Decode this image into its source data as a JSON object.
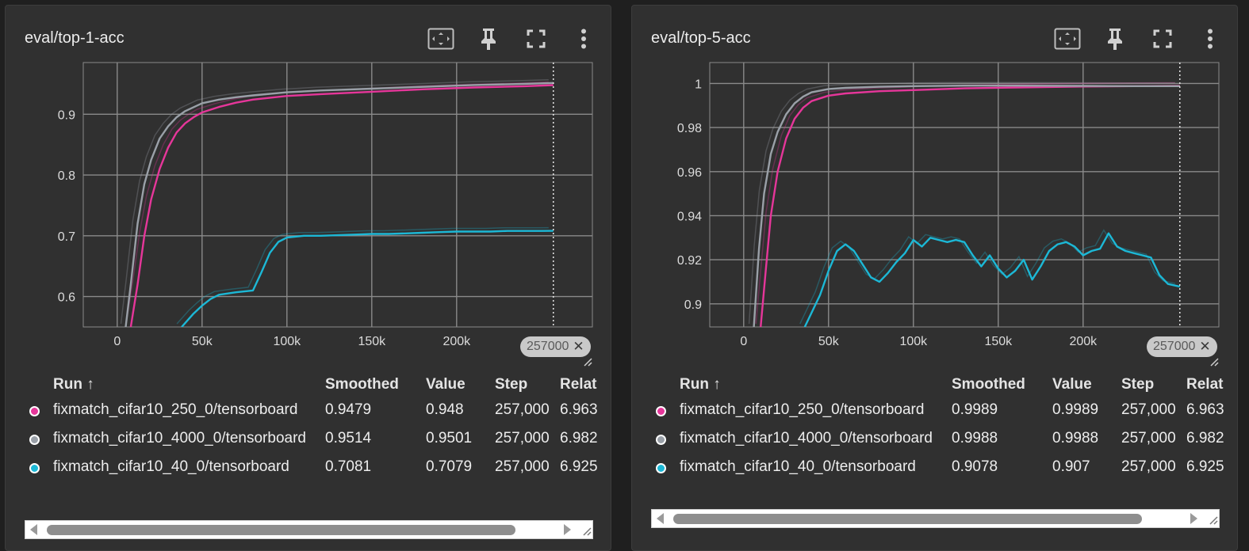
{
  "colors": {
    "background": "#1f1f1f",
    "card": "#303030",
    "grid": "#8a8a8a",
    "magenta": "#e6369a",
    "gray": "#9aa0a8",
    "cyan": "#1cb8d6"
  },
  "icons": [
    "fit-domain-icon",
    "pin-icon",
    "fullscreen-icon",
    "more-vert-icon",
    "close-icon",
    "resize-icon",
    "scroll-left-icon",
    "scroll-right-icon"
  ],
  "table_headers": {
    "run": "Run ↑",
    "smoothed": "Smoothed",
    "value": "Value",
    "step": "Step",
    "relative": "Relat"
  },
  "panels": [
    {
      "title": "eval/top-1-acc",
      "range_chip": "257000",
      "rows": [
        {
          "run": "fixmatch_cifar10_250_0/tensorboard",
          "smoothed": "0.9479",
          "value": "0.948",
          "step": "257,000",
          "relative": "6.963",
          "color": "#e6369a"
        },
        {
          "run": "fixmatch_cifar10_4000_0/tensorboard",
          "smoothed": "0.9514",
          "value": "0.9501",
          "step": "257,000",
          "relative": "6.982",
          "color": "#9aa0a8"
        },
        {
          "run": "fixmatch_cifar10_40_0/tensorboard",
          "smoothed": "0.7081",
          "value": "0.7079",
          "step": "257,000",
          "relative": "6.925",
          "color": "#1cb8d6"
        }
      ]
    },
    {
      "title": "eval/top-5-acc",
      "range_chip": "257000",
      "rows": [
        {
          "run": "fixmatch_cifar10_250_0/tensorboard",
          "smoothed": "0.9989",
          "value": "0.9989",
          "step": "257,000",
          "relative": "6.963",
          "color": "#e6369a"
        },
        {
          "run": "fixmatch_cifar10_4000_0/tensorboard",
          "smoothed": "0.9988",
          "value": "0.9988",
          "step": "257,000",
          "relative": "6.982",
          "color": "#9aa0a8"
        },
        {
          "run": "fixmatch_cifar10_40_0/tensorboard",
          "smoothed": "0.9078",
          "value": "0.907",
          "step": "257,000",
          "relative": "6.925",
          "color": "#1cb8d6"
        }
      ]
    }
  ],
  "chart_data": [
    {
      "type": "line",
      "title": "eval/top-1-acc",
      "xlim": [
        -20000,
        280000
      ],
      "ylim": [
        0.55,
        0.985
      ],
      "xticks": [
        0,
        50000,
        100000,
        150000,
        200000
      ],
      "xtick_labels": [
        "0",
        "50k",
        "100k",
        "150k",
        "200k"
      ],
      "yticks": [
        0.6,
        0.7,
        0.8,
        0.9
      ],
      "ytick_labels": [
        "0.6",
        "0.7",
        "0.8",
        "0.9"
      ],
      "grid": true,
      "cursor_x": 257000,
      "series": [
        {
          "name": "fixmatch_cifar10_250_0/tensorboard",
          "color": "#e6369a",
          "x": [
            8000,
            12000,
            16000,
            20000,
            25000,
            30000,
            35000,
            40000,
            45000,
            50000,
            60000,
            70000,
            80000,
            100000,
            120000,
            150000,
            180000,
            210000,
            240000,
            257000
          ],
          "y": [
            0.55,
            0.62,
            0.7,
            0.76,
            0.81,
            0.845,
            0.87,
            0.885,
            0.895,
            0.903,
            0.912,
            0.919,
            0.924,
            0.93,
            0.933,
            0.937,
            0.941,
            0.944,
            0.946,
            0.9479
          ]
        },
        {
          "name": "fixmatch_cifar10_4000_0/tensorboard",
          "color": "#9aa0a8",
          "x": [
            5000,
            8000,
            12000,
            16000,
            20000,
            25000,
            30000,
            35000,
            40000,
            50000,
            60000,
            70000,
            80000,
            100000,
            120000,
            150000,
            180000,
            210000,
            240000,
            257000
          ],
          "y": [
            0.55,
            0.62,
            0.72,
            0.785,
            0.825,
            0.86,
            0.88,
            0.895,
            0.905,
            0.918,
            0.924,
            0.928,
            0.931,
            0.936,
            0.939,
            0.942,
            0.945,
            0.948,
            0.95,
            0.9514
          ]
        },
        {
          "name": "fixmatch_cifar10_40_0/tensorboard",
          "color": "#1cb8d6",
          "x": [
            38000,
            45000,
            50000,
            55000,
            60000,
            70000,
            80000,
            85000,
            90000,
            95000,
            100000,
            110000,
            120000,
            130000,
            140000,
            150000,
            160000,
            170000,
            180000,
            190000,
            200000,
            210000,
            220000,
            230000,
            240000,
            250000,
            257000
          ],
          "y": [
            0.55,
            0.572,
            0.585,
            0.596,
            0.603,
            0.607,
            0.61,
            0.64,
            0.672,
            0.69,
            0.697,
            0.7,
            0.7,
            0.701,
            0.702,
            0.703,
            0.703,
            0.704,
            0.705,
            0.706,
            0.707,
            0.707,
            0.707,
            0.708,
            0.708,
            0.708,
            0.7081
          ]
        }
      ]
    },
    {
      "type": "line",
      "title": "eval/top-5-acc",
      "xlim": [
        -20000,
        280000
      ],
      "ylim": [
        0.8895,
        1.0095
      ],
      "xticks": [
        0,
        50000,
        100000,
        150000,
        200000
      ],
      "xtick_labels": [
        "0",
        "50k",
        "100k",
        "150k",
        "200k"
      ],
      "yticks": [
        0.9,
        0.92,
        0.94,
        0.96,
        0.98,
        1.0
      ],
      "ytick_labels": [
        "0.9",
        "0.92",
        "0.94",
        "0.96",
        "0.98",
        "1"
      ],
      "grid": true,
      "cursor_x": 257000,
      "series": [
        {
          "name": "fixmatch_cifar10_250_0/tensorboard",
          "color": "#e6369a",
          "x": [
            10000,
            13000,
            16000,
            20000,
            25000,
            30000,
            35000,
            40000,
            50000,
            60000,
            80000,
            100000,
            130000,
            160000,
            200000,
            230000,
            257000
          ],
          "y": [
            0.8895,
            0.915,
            0.94,
            0.96,
            0.975,
            0.984,
            0.989,
            0.992,
            0.9945,
            0.9955,
            0.9965,
            0.997,
            0.9978,
            0.9982,
            0.9986,
            0.9988,
            0.9989
          ]
        },
        {
          "name": "fixmatch_cifar10_4000_0/tensorboard",
          "color": "#9aa0a8",
          "x": [
            6000,
            9000,
            12000,
            16000,
            20000,
            25000,
            30000,
            35000,
            40000,
            50000,
            60000,
            80000,
            100000,
            130000,
            160000,
            200000,
            230000,
            257000
          ],
          "y": [
            0.8895,
            0.925,
            0.95,
            0.968,
            0.978,
            0.986,
            0.991,
            0.994,
            0.996,
            0.9975,
            0.998,
            0.9985,
            0.9988,
            0.999,
            0.999,
            0.9989,
            0.9988,
            0.9988
          ]
        },
        {
          "name": "fixmatch_cifar10_40_0/tensorboard",
          "color": "#1cb8d6",
          "x": [
            36000,
            45000,
            50000,
            55000,
            60000,
            65000,
            70000,
            75000,
            80000,
            85000,
            90000,
            95000,
            100000,
            105000,
            110000,
            115000,
            120000,
            125000,
            130000,
            135000,
            140000,
            145000,
            150000,
            155000,
            160000,
            165000,
            170000,
            175000,
            180000,
            185000,
            190000,
            195000,
            200000,
            205000,
            210000,
            215000,
            220000,
            225000,
            230000,
            235000,
            240000,
            245000,
            250000,
            257000
          ],
          "y": [
            0.8895,
            0.904,
            0.915,
            0.924,
            0.927,
            0.924,
            0.918,
            0.912,
            0.91,
            0.914,
            0.919,
            0.923,
            0.929,
            0.926,
            0.93,
            0.929,
            0.928,
            0.929,
            0.928,
            0.922,
            0.917,
            0.922,
            0.916,
            0.912,
            0.915,
            0.92,
            0.911,
            0.917,
            0.924,
            0.927,
            0.928,
            0.926,
            0.922,
            0.924,
            0.925,
            0.932,
            0.926,
            0.924,
            0.923,
            0.922,
            0.921,
            0.913,
            0.909,
            0.9078
          ]
        }
      ]
    }
  ]
}
